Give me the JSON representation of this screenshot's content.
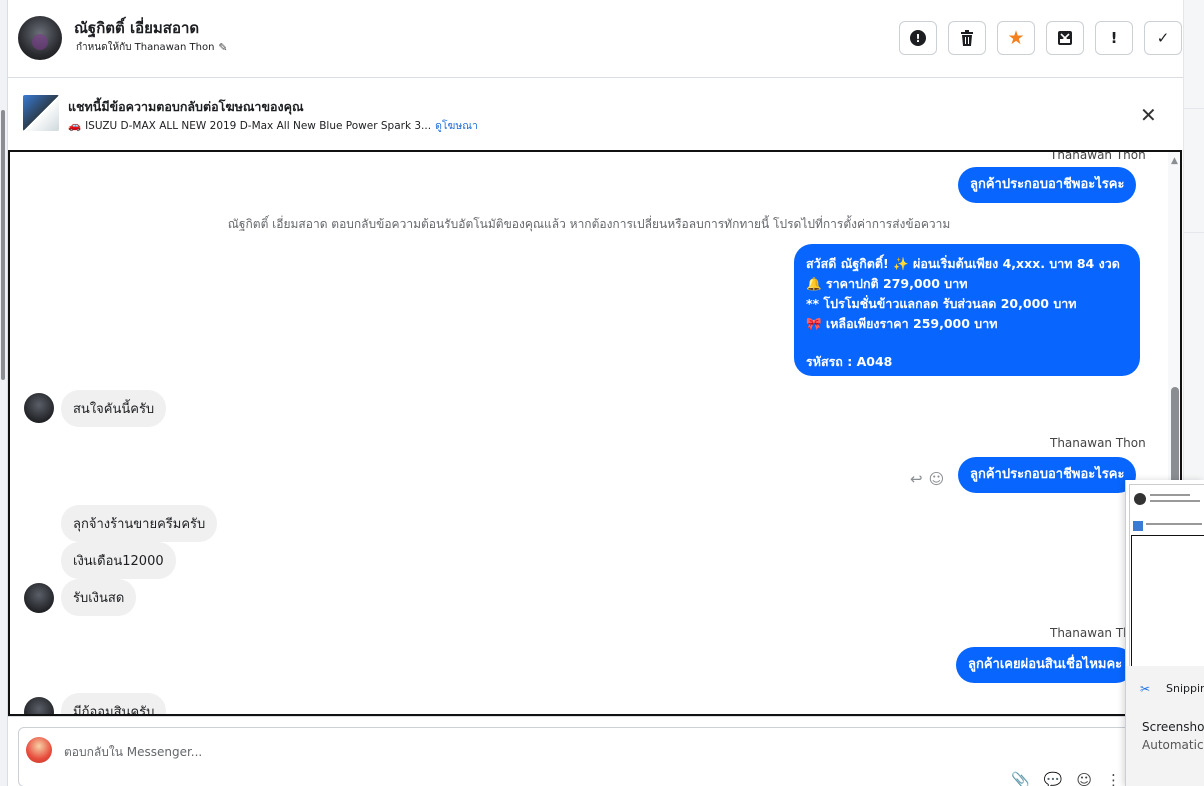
{
  "header": {
    "contact_name": "ณัฐกิตติ์ เอี่ยมสอาด",
    "assigned_to": "กำหนดให้กับ Thanawan Thon",
    "actions": [
      {
        "name": "report-icon",
        "glyph": "!"
      },
      {
        "name": "trash-icon",
        "glyph": "🗑"
      },
      {
        "name": "star-icon",
        "glyph": "★"
      },
      {
        "name": "archive-icon",
        "glyph": "⊠"
      },
      {
        "name": "exclamation-icon",
        "glyph": "!"
      },
      {
        "name": "check-icon",
        "glyph": "✓"
      }
    ]
  },
  "ad_banner": {
    "title": "แชทนี้มีข้อความตอบกลับต่อโฆษณาของคุณ",
    "ad_text": "ISUZU D-MAX ALL NEW 2019 D-Max All New Blue Power Spark 3...",
    "view_ad_link": "ดูโฆษณา",
    "close_glyph": "✕"
  },
  "messages": {
    "sender_top": "Thanawan Thon",
    "out_1": "ลูกค้าประกอบอาชีพอะไรคะ",
    "system_note": "ณัฐกิตติ์ เอี่ยมสอาด ตอบกลับข้อความต้อนรับอัตโนมัติของคุณแล้ว หากต้องการเปลี่ยนหรือลบการทักทายนี้ โปรดไปที่การตั้งค่าการส่งข้อความ",
    "promo": {
      "line1": "สวัสดี ณัฐกิตติ์! ✨  ผ่อนเริ่มต้นเพียง 4,xxx. บาท 84 งวด",
      "line2": "🔔 ราคาปกติ 279,000 บาท",
      "line3": "** โปรโมชั่นข้าวแลกลด รับส่วนลด 20,000 บาท",
      "line4": "🎀  เหลือเพียงราคา 259,000 บาท",
      "line5": "รหัสรถ : A048"
    },
    "in_1": "สนใจคันนี้ครับ",
    "sender_2": "Thanawan Thon",
    "out_2": "ลูกค้าประกอบอาชีพอะไรคะ",
    "in_2": "ลุกจ้างร้านขายครีมครับ",
    "in_3": "เงินเดือน12000",
    "in_4": "รับเงินสด",
    "sender_3": "Thanawan Thon",
    "out_3": "ลูกค้าเคยผ่อนสินเชื่อไหมคะ",
    "in_5": "มีก้ออมสินครับ"
  },
  "composer": {
    "placeholder": "ตอบกลับใน Messenger..."
  },
  "snipping_overlay": {
    "app_name": "Snippin",
    "line1": "Screensho",
    "line2": "Automatic"
  },
  "colors": {
    "outgoing_bubble": "#0866ff",
    "incoming_bubble": "#f0f0f0",
    "star": "#f5801f",
    "link": "#216fdb"
  }
}
